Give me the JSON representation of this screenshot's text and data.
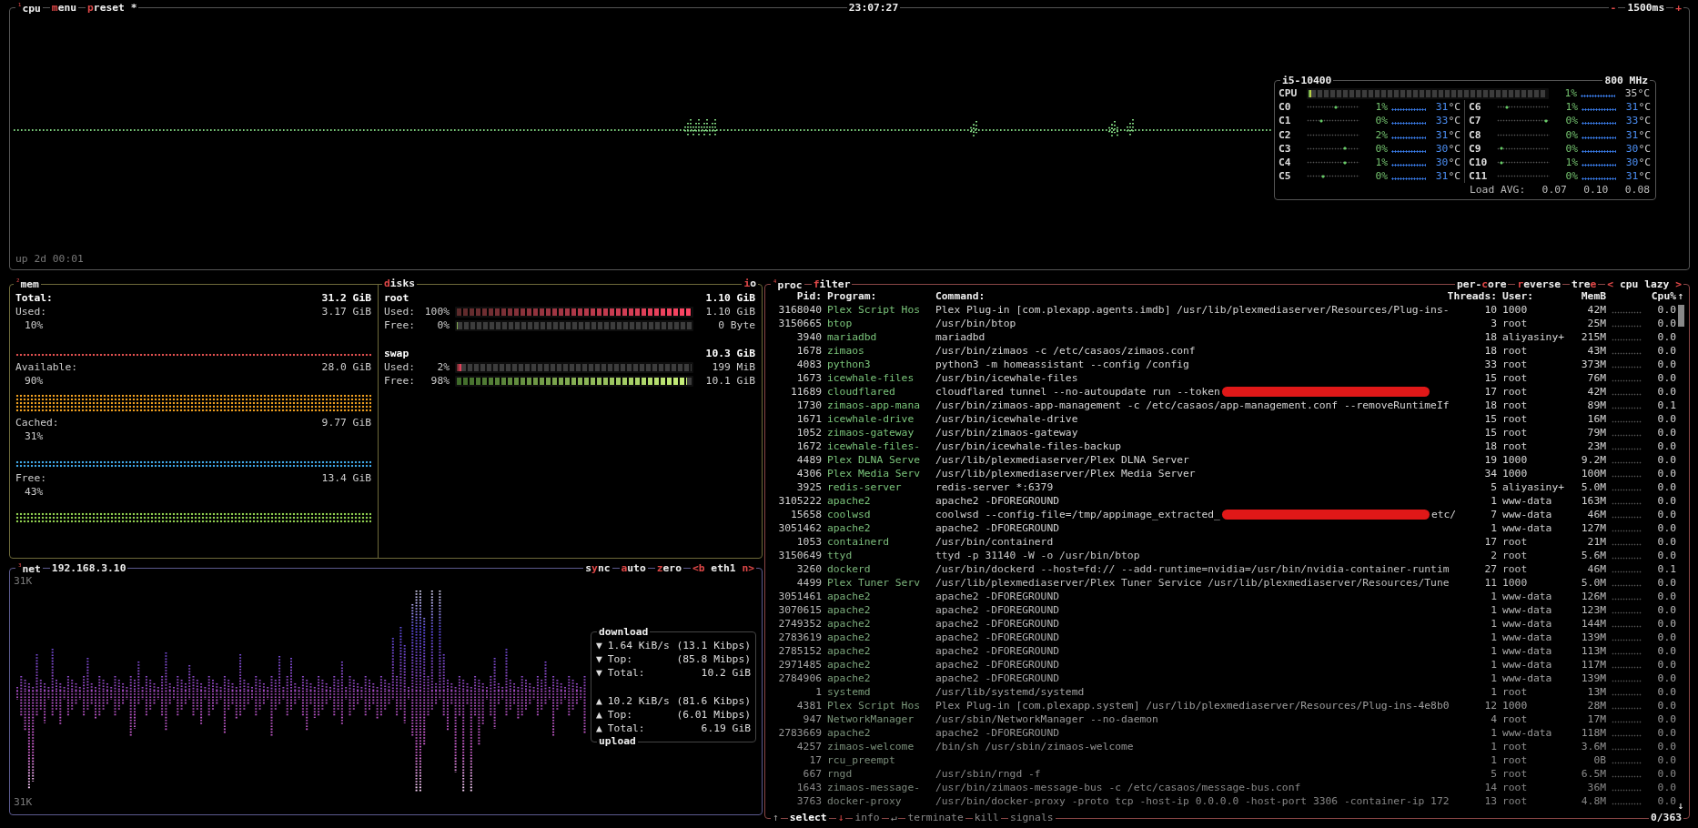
{
  "cpu": {
    "number": "¹",
    "title": "cpu",
    "tabs": [
      {
        "key": "m",
        "after": "enu"
      },
      {
        "key": "p",
        "after": "reset *"
      }
    ],
    "clock": "23:07:27",
    "rate": {
      "minus": "-",
      "value": "1500ms",
      "plus": "+"
    },
    "uptime": "up 2d 00:01",
    "panel": {
      "model": "i5-10400",
      "freq": "800 MHz",
      "total": {
        "label": "CPU",
        "level": 0.01,
        "percent": "1%",
        "temp": "35",
        "unit": "°C"
      },
      "cores": [
        {
          "label": "C0",
          "percent": "1%",
          "temp": "31",
          "unit": "°C"
        },
        {
          "label": "C1",
          "percent": "0%",
          "temp": "33",
          "unit": "°C"
        },
        {
          "label": "C2",
          "percent": "2%",
          "temp": "31",
          "unit": "°C"
        },
        {
          "label": "C3",
          "percent": "0%",
          "temp": "30",
          "unit": "°C"
        },
        {
          "label": "C4",
          "percent": "1%",
          "temp": "30",
          "unit": "°C"
        },
        {
          "label": "C5",
          "percent": "0%",
          "temp": "31",
          "unit": "°C"
        },
        {
          "label": "C6",
          "percent": "1%",
          "temp": "31",
          "unit": "°C"
        },
        {
          "label": "C7",
          "percent": "0%",
          "temp": "33",
          "unit": "°C"
        },
        {
          "label": "C8",
          "percent": "0%",
          "temp": "31",
          "unit": "°C"
        },
        {
          "label": "C9",
          "percent": "0%",
          "temp": "30",
          "unit": "°C"
        },
        {
          "label": "C10",
          "percent": "1%",
          "temp": "30",
          "unit": "°C"
        },
        {
          "label": "C11",
          "percent": "0%",
          "temp": "31",
          "unit": "°C"
        }
      ],
      "load_label": "Load AVG:",
      "load": [
        "0.07",
        "0.10",
        "0.08"
      ]
    }
  },
  "mem": {
    "number": "²",
    "title": "mem",
    "total_label": "Total:",
    "total": "31.2 GiB",
    "items": [
      {
        "label": "Used:",
        "value": "3.17 GiB",
        "percent": "10%",
        "color": "#e05050"
      },
      {
        "label": "Available:",
        "value": "28.0 GiB",
        "percent": "90%",
        "color": "#f0a020"
      },
      {
        "label": "Cached:",
        "value": "9.77 GiB",
        "percent": "31%",
        "color": "#40a8e8"
      },
      {
        "label": "Free:",
        "value": "13.4 GiB",
        "percent": "43%",
        "color": "#90d050"
      }
    ]
  },
  "disks": {
    "title": {
      "key": "d",
      "after": "isks"
    },
    "io": {
      "key": "i",
      "after": "o"
    },
    "devices": [
      {
        "name": "root",
        "size": "1.10 GiB",
        "rows": [
          {
            "kind": "used",
            "label": "Used:",
            "percent": "100%",
            "level": 1.0,
            "value": "1.10 GiB"
          },
          {
            "kind": "free",
            "label": "Free:",
            "percent": "0%",
            "level": 0,
            "value": "0 Byte"
          }
        ]
      },
      {
        "name": "swap",
        "size": "10.3 GiB",
        "rows": [
          {
            "kind": "used",
            "label": "Used:",
            "percent": "2%",
            "level": 0.02,
            "value": "199 MiB"
          },
          {
            "kind": "free",
            "label": "Free:",
            "percent": "98%",
            "level": 0.98,
            "value": "10.1 GiB"
          }
        ]
      }
    ]
  },
  "net": {
    "number": "³",
    "title": "net",
    "ip": "192.168.3.10",
    "options": [
      {
        "before": "s",
        "key": "y",
        "after": "nc"
      },
      {
        "key": "a",
        "after": "uto"
      },
      {
        "key": "z",
        "after": "ero"
      }
    ],
    "interface": {
      "prev": "<b",
      "name": "eth1",
      "next": "n>"
    },
    "scale_top": "31K",
    "scale_bottom": "31K",
    "download": {
      "title": "download",
      "rows": [
        {
          "arrow": "▼",
          "label": "1.64 KiB/s",
          "value": "(13.1 Kibps)"
        },
        {
          "arrow": "▼",
          "label": "Top:",
          "value": "(85.8 Mibps)"
        },
        {
          "arrow": "▼",
          "label": "Total:",
          "value": "10.2 GiB"
        }
      ]
    },
    "upload": {
      "title": "upload",
      "rows": [
        {
          "arrow": "▲",
          "label": "10.2 KiB/s",
          "value": "(81.6 Kibps)"
        },
        {
          "arrow": "▲",
          "label": "Top:",
          "value": "(6.01 Mibps)"
        },
        {
          "arrow": "▲",
          "label": "Total:",
          "value": "6.19 GiB"
        }
      ]
    }
  },
  "proc": {
    "number": "⁴",
    "title": "proc",
    "filter": {
      "key": "f",
      "after": "ilter"
    },
    "options": [
      {
        "before": "per-",
        "key": "c",
        "after": "ore"
      },
      {
        "key": "r",
        "after": "everse"
      },
      {
        "before": "tre",
        "key": "e"
      }
    ],
    "sort": {
      "prev": "<",
      "name": "cpu lazy",
      "next": ">"
    },
    "columns": {
      "pid": "Pid:",
      "program": "Program:",
      "command": "Command:",
      "threads": "Threads:",
      "user": "User:",
      "mem": "MemB",
      "cpu": "Cpu%"
    },
    "rows": [
      {
        "pid": "3168040",
        "program": "Plex Script Hos",
        "command": "Plex Plug-in [com.plexapp.agents.imdb] /usr/lib/plexmediaserver/Resources/Plug-ins-",
        "threads": "10",
        "user": "1000",
        "mem": "42M",
        "cpu": "0.0"
      },
      {
        "pid": "3150665",
        "program": "btop",
        "command": "/usr/bin/btop",
        "threads": "3",
        "user": "root",
        "mem": "25M",
        "cpu": "0.0"
      },
      {
        "pid": "3940",
        "program": "mariadbd",
        "command": "mariadbd",
        "threads": "18",
        "user": "aliyasiny+",
        "mem": "215M",
        "cpu": "0.0"
      },
      {
        "pid": "1678",
        "program": "zimaos",
        "command": "/usr/bin/zimaos -c /etc/casaos/zimaos.conf",
        "threads": "18",
        "user": "root",
        "mem": "43M",
        "cpu": "0.0"
      },
      {
        "pid": "4083",
        "program": "python3",
        "command": "python3 -m homeassistant --config /config",
        "threads": "33",
        "user": "root",
        "mem": "373M",
        "cpu": "0.0"
      },
      {
        "pid": "1673",
        "program": "icewhale-files",
        "command": "/usr/bin/icewhale-files",
        "threads": "15",
        "user": "root",
        "mem": "76M",
        "cpu": "0.0"
      },
      {
        "pid": "11689",
        "program": "cloudflared",
        "command": "cloudflared tunnel --no-autoupdate run --token",
        "redacted": true,
        "threads": "17",
        "user": "root",
        "mem": "42M",
        "cpu": "0.0"
      },
      {
        "pid": "1730",
        "program": "zimaos-app-mana",
        "command": "/usr/bin/zimaos-app-management -c /etc/casaos/app-management.conf --removeRuntimeIf",
        "threads": "18",
        "user": "root",
        "mem": "89M",
        "cpu": "0.1"
      },
      {
        "pid": "1671",
        "program": "icewhale-drive",
        "command": "/usr/bin/icewhale-drive",
        "threads": "15",
        "user": "root",
        "mem": "16M",
        "cpu": "0.0"
      },
      {
        "pid": "1052",
        "program": "zimaos-gateway",
        "command": "/usr/bin/zimaos-gateway",
        "threads": "15",
        "user": "root",
        "mem": "79M",
        "cpu": "0.0"
      },
      {
        "pid": "1672",
        "program": "icewhale-files-",
        "command": "/usr/bin/icewhale-files-backup",
        "threads": "18",
        "user": "root",
        "mem": "23M",
        "cpu": "0.0"
      },
      {
        "pid": "4489",
        "program": "Plex DLNA Serve",
        "command": "/usr/lib/plexmediaserver/Plex DLNA Server",
        "threads": "19",
        "user": "1000",
        "mem": "9.2M",
        "cpu": "0.0"
      },
      {
        "pid": "4306",
        "program": "Plex Media Serv",
        "command": "/usr/lib/plexmediaserver/Plex Media Server",
        "threads": "34",
        "user": "1000",
        "mem": "100M",
        "cpu": "0.0"
      },
      {
        "pid": "3925",
        "program": "redis-server",
        "command": "redis-server *:6379",
        "threads": "5",
        "user": "aliyasiny+",
        "mem": "5.0M",
        "cpu": "0.0"
      },
      {
        "pid": "3105222",
        "program": "apache2",
        "command": "apache2 -DFOREGROUND",
        "threads": "1",
        "user": "www-data",
        "mem": "163M",
        "cpu": "0.0"
      },
      {
        "pid": "15658",
        "program": "coolwsd",
        "command": "coolwsd --config-file=/tmp/appimage_extracted_",
        "redacted": true,
        "tail": "etc/",
        "threads": "7",
        "user": "www-data",
        "mem": "46M",
        "cpu": "0.0"
      },
      {
        "pid": "3051462",
        "program": "apache2",
        "command": "apache2 -DFOREGROUND",
        "threads": "1",
        "user": "www-data",
        "mem": "127M",
        "cpu": "0.0"
      },
      {
        "pid": "1053",
        "program": "containerd",
        "command": "/usr/bin/containerd",
        "threads": "17",
        "user": "root",
        "mem": "21M",
        "cpu": "0.0"
      },
      {
        "pid": "3150649",
        "program": "ttyd",
        "command": "ttyd -p 31140 -W -o /usr/bin/btop",
        "threads": "2",
        "user": "root",
        "mem": "5.6M",
        "cpu": "0.0"
      },
      {
        "pid": "3260",
        "program": "dockerd",
        "command": "/usr/bin/dockerd --host=fd:// --add-runtime=nvidia=/usr/bin/nvidia-container-runtim",
        "threads": "27",
        "user": "root",
        "mem": "46M",
        "cpu": "0.1"
      },
      {
        "pid": "4499",
        "program": "Plex Tuner Serv",
        "command": "/usr/lib/plexmediaserver/Plex Tuner Service /usr/lib/plexmediaserver/Resources/Tune",
        "threads": "11",
        "user": "1000",
        "mem": "5.0M",
        "cpu": "0.0"
      },
      {
        "pid": "3051461",
        "program": "apache2",
        "command": "apache2 -DFOREGROUND",
        "threads": "1",
        "user": "www-data",
        "mem": "126M",
        "cpu": "0.0"
      },
      {
        "pid": "3070615",
        "program": "apache2",
        "command": "apache2 -DFOREGROUND",
        "threads": "1",
        "user": "www-data",
        "mem": "123M",
        "cpu": "0.0"
      },
      {
        "pid": "2749352",
        "program": "apache2",
        "command": "apache2 -DFOREGROUND",
        "threads": "1",
        "user": "www-data",
        "mem": "144M",
        "cpu": "0.0"
      },
      {
        "pid": "2783619",
        "program": "apache2",
        "command": "apache2 -DFOREGROUND",
        "threads": "1",
        "user": "www-data",
        "mem": "139M",
        "cpu": "0.0"
      },
      {
        "pid": "2785152",
        "program": "apache2",
        "command": "apache2 -DFOREGROUND",
        "threads": "1",
        "user": "www-data",
        "mem": "113M",
        "cpu": "0.0"
      },
      {
        "pid": "2971485",
        "program": "apache2",
        "command": "apache2 -DFOREGROUND",
        "threads": "1",
        "user": "www-data",
        "mem": "117M",
        "cpu": "0.0"
      },
      {
        "pid": "2784906",
        "program": "apache2",
        "command": "apache2 -DFOREGROUND",
        "threads": "1",
        "user": "www-data",
        "mem": "139M",
        "cpu": "0.0"
      },
      {
        "pid": "1",
        "program": "systemd",
        "command": "/usr/lib/systemd/systemd",
        "threads": "1",
        "user": "root",
        "mem": "13M",
        "cpu": "0.0"
      },
      {
        "pid": "4381",
        "program": "Plex Script Hos",
        "command": "Plex Plug-in [com.plexapp.system] /usr/lib/plexmediaserver/Resources/Plug-ins-4e8b0",
        "threads": "12",
        "user": "1000",
        "mem": "28M",
        "cpu": "0.0"
      },
      {
        "pid": "947",
        "program": "NetworkManager",
        "command": "/usr/sbin/NetworkManager --no-daemon",
        "threads": "4",
        "user": "root",
        "mem": "17M",
        "cpu": "0.0"
      },
      {
        "pid": "2783669",
        "program": "apache2",
        "command": "apache2 -DFOREGROUND",
        "threads": "1",
        "user": "www-data",
        "mem": "118M",
        "cpu": "0.0"
      },
      {
        "pid": "4257",
        "program": "zimaos-welcome",
        "command": "/bin/sh /usr/sbin/zimaos-welcome",
        "threads": "1",
        "user": "root",
        "mem": "3.6M",
        "cpu": "0.0"
      },
      {
        "pid": "17",
        "program": "rcu_preempt",
        "threads": "1",
        "user": "root",
        "mem": "0B",
        "cpu": "0.0"
      },
      {
        "pid": "667",
        "program": "rngd",
        "command": "/usr/sbin/rngd -f",
        "threads": "5",
        "user": "root",
        "mem": "6.5M",
        "cpu": "0.0"
      },
      {
        "pid": "1643",
        "program": "zimaos-message-",
        "command": "/usr/bin/zimaos-message-bus -c /etc/casaos/message-bus.conf",
        "threads": "14",
        "user": "root",
        "mem": "36M",
        "cpu": "0.0"
      },
      {
        "pid": "3763",
        "program": "docker-proxy",
        "command": "/usr/bin/docker-proxy -proto tcp -host-ip 0.0.0.0 -host-port 3306 -container-ip 172",
        "threads": "13",
        "user": "root",
        "mem": "4.8M",
        "cpu": "0.0"
      }
    ],
    "scroll": {
      "up": "↑",
      "down": "↓"
    },
    "footer": {
      "items": [
        {
          "kind": "arrow",
          "text": "↑"
        },
        {
          "kind": "active",
          "text": "select"
        },
        {
          "kind": "key",
          "text": "↓"
        },
        {
          "kind": "label",
          "text": "info"
        },
        {
          "kind": "arrow",
          "text": "↵"
        },
        {
          "kind": "label",
          "text": "terminate"
        },
        {
          "kind": "label",
          "text": "kill"
        },
        {
          "kind": "label",
          "text": "signals"
        }
      ],
      "count": "0/363"
    }
  }
}
